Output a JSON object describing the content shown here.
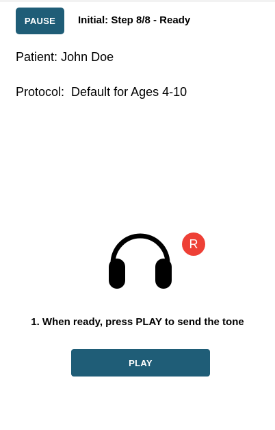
{
  "header": {
    "pause_label": "PAUSE",
    "step_status": "Initial: Step 8/8 - Ready"
  },
  "patient": {
    "label": "Patient:",
    "name": "John Doe"
  },
  "protocol": {
    "label": "Protocol:",
    "value": "Default for Ages 4-10"
  },
  "test": {
    "icon": "headphones-icon",
    "ear_badge": "R",
    "ear_badge_color": "#ee4036",
    "instruction": "1. When ready, press PLAY to send the tone",
    "play_label": "PLAY"
  },
  "colors": {
    "primary": "#1f5d77",
    "text": "#000000",
    "background": "#ffffff"
  }
}
